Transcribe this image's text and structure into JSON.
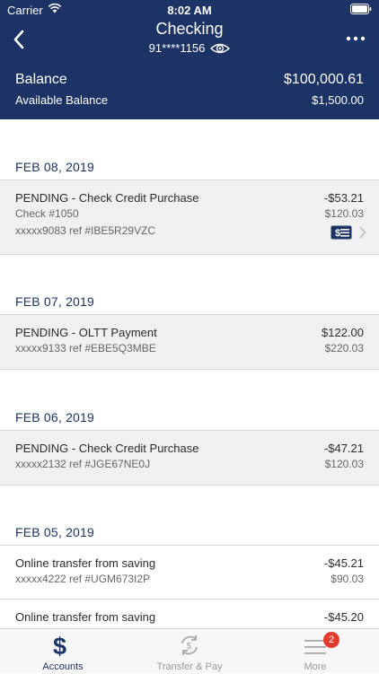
{
  "status_bar": {
    "carrier": "Carrier",
    "time": "8:02 AM"
  },
  "header": {
    "title": "Checking",
    "account_number": "91****1156",
    "balance_label": "Balance",
    "balance_value": "$100,000.61",
    "available_label": "Available Balance",
    "available_value": "$1,500.00",
    "colors": {
      "background": "#1c3366"
    }
  },
  "groups": [
    {
      "date": "FEB 08, 2019",
      "transactions": [
        {
          "description": "PENDING - Check Credit Purchase",
          "amount": "-$53.21",
          "line2": "Check #1050",
          "balance": "$120.03",
          "line3": "xxxxx9083 ref #IBE5R29VZC",
          "icon": "check-icon"
        }
      ]
    },
    {
      "date": "FEB 07, 2019",
      "transactions": [
        {
          "description": "PENDING - OLTT Payment",
          "amount": "$122.00",
          "line2": "xxxxx9133 ref #EBE5Q3MBE",
          "balance": "$220.03"
        }
      ]
    },
    {
      "date": "FEB 06, 2019",
      "transactions": [
        {
          "description": "PENDING - Check Credit Purchase",
          "amount": "-$47.21",
          "line2": "xxxxx2132 ref #JGE67NE0J",
          "balance": "$120.03"
        }
      ]
    },
    {
      "date": "FEB 05, 2019",
      "transactions": [
        {
          "description": "Online transfer from saving",
          "amount": "-$45.21",
          "line2": "xxxxx4222 ref #UGM673I2P",
          "balance": "$90.03"
        },
        {
          "description": "Online transfer from saving",
          "amount": "-$45.20"
        }
      ]
    }
  ],
  "tabbar": {
    "tabs": [
      {
        "label": "Accounts",
        "icon": "dollar-icon",
        "active": true
      },
      {
        "label": "Transfer & Pay",
        "icon": "transfer-icon"
      },
      {
        "label": "More",
        "icon": "menu-icon",
        "badge": "2"
      }
    ],
    "dollar_glyph": "$"
  }
}
